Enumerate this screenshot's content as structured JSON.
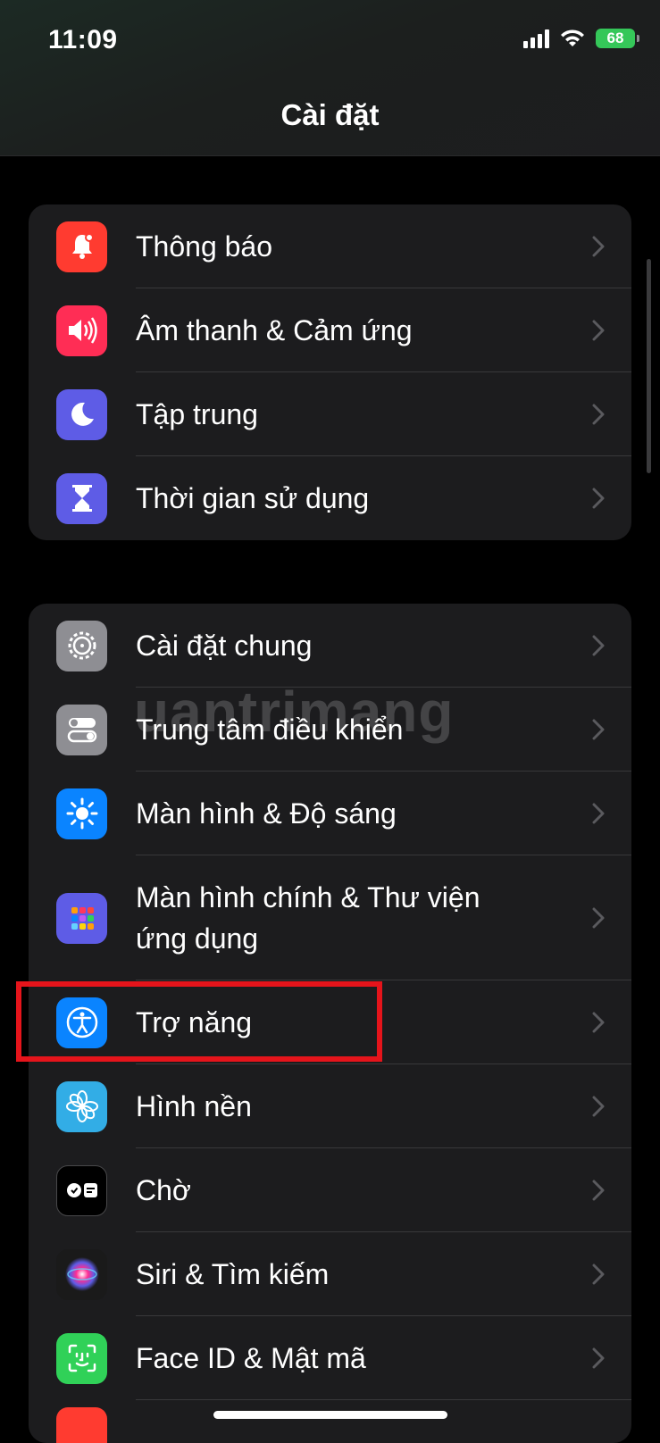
{
  "status_bar": {
    "time": "11:09",
    "battery": "68"
  },
  "nav": {
    "title": "Cài đặt"
  },
  "group1": [
    {
      "label": "Thông báo",
      "icon": "bell-icon",
      "color": "#ff3b30"
    },
    {
      "label": "Âm thanh & Cảm ứng",
      "icon": "speaker-icon",
      "color": "#ff2d55"
    },
    {
      "label": "Tập trung",
      "icon": "moon-icon",
      "color": "#5e5ce6"
    },
    {
      "label": "Thời gian sử dụng",
      "icon": "hourglass-icon",
      "color": "#5e5ce6"
    }
  ],
  "group2": [
    {
      "label": "Cài đặt chung",
      "icon": "gear-icon",
      "color": "#8e8e93"
    },
    {
      "label": "Trung tâm điều khiển",
      "icon": "toggles-icon",
      "color": "#8e8e93"
    },
    {
      "label": "Màn hình & Độ sáng",
      "icon": "sun-icon",
      "color": "#0a84ff"
    },
    {
      "label": "Màn hình chính & Thư viện ứng dụng",
      "icon": "app-grid-icon",
      "color": "#5e5ce6"
    },
    {
      "label": "Trợ năng",
      "icon": "accessibility-icon",
      "color": "#0a84ff"
    },
    {
      "label": "Hình nền",
      "icon": "flower-icon",
      "color": "#32ade6"
    },
    {
      "label": "Chờ",
      "icon": "standby-icon",
      "color": "#000000"
    },
    {
      "label": "Siri & Tìm kiếm",
      "icon": "siri-icon",
      "color": "#222222"
    },
    {
      "label": "Face ID & Mật mã",
      "icon": "faceid-icon",
      "color": "#30d158"
    }
  ],
  "watermark": "uantrimang"
}
